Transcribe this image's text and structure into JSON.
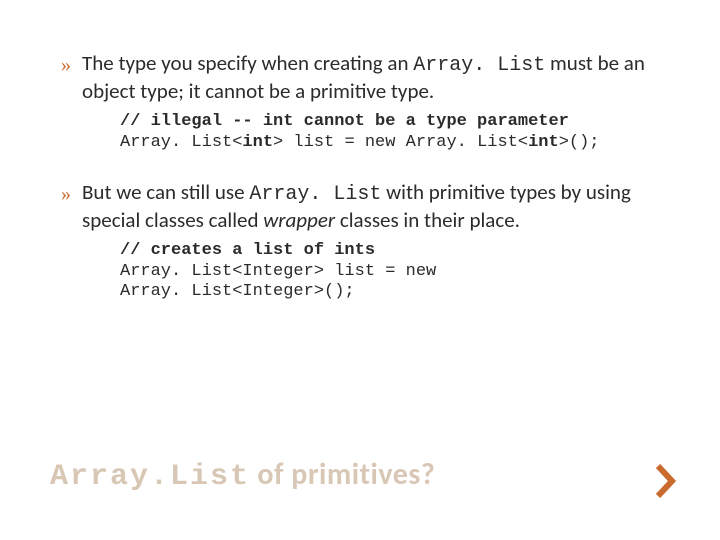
{
  "bullets": [
    {
      "marker": "»",
      "pre": "The type you specify when creating an ",
      "code": "Array. List",
      "post": " must be an object type; it cannot be a primitive type."
    },
    {
      "marker": "»",
      "pre": "But we can still use ",
      "code": "Array. List",
      "post": " with primitive types by using special classes called ",
      "italic": "wrapper",
      "tail": " classes in their place."
    }
  ],
  "code1": {
    "comment": "// illegal -- int cannot be a type parameter",
    "line_a": "Array. List<",
    "line_b_bold": "int",
    "line_c": "> list = new Array. List<",
    "line_d_bold": "int",
    "line_e": ">();"
  },
  "code2": {
    "comment": "// creates a list of ints",
    "line1": "Array. List<Integer> list = new",
    "line2": "Array. List<Integer>();"
  },
  "title": {
    "tt": "Array.List",
    "rest": " of primitives?"
  }
}
